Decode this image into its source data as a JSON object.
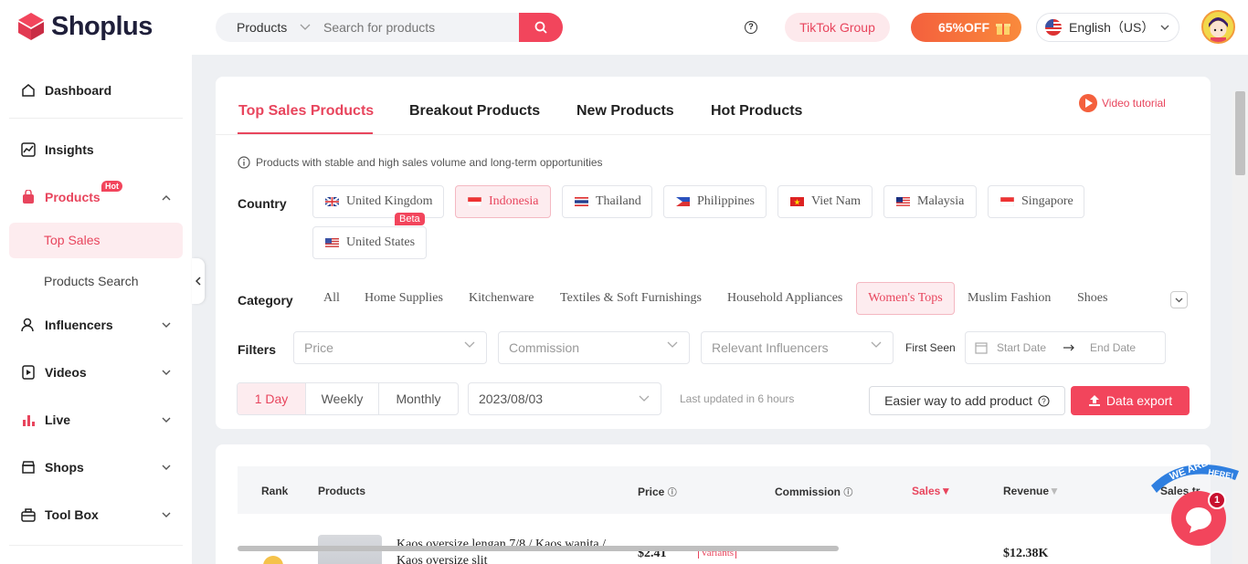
{
  "app": {
    "brand": "Shoplus"
  },
  "header": {
    "search_scope": "Products",
    "search_placeholder": "Search for products",
    "tiktok_label": "TikTok Group",
    "promo_label": "65%OFF",
    "language_label": "English（US）"
  },
  "sidebar": {
    "items": [
      {
        "label": "Dashboard",
        "icon": "home-icon"
      },
      {
        "label": "Insights",
        "icon": "chart-line-icon"
      },
      {
        "label": "Products",
        "icon": "bag-icon",
        "badge": "Hot"
      },
      {
        "label": "Influencers",
        "icon": "user-icon"
      },
      {
        "label": "Videos",
        "icon": "video-icon"
      },
      {
        "label": "Live",
        "icon": "bar-chart-icon"
      },
      {
        "label": "Shops",
        "icon": "shop-icon"
      },
      {
        "label": "Tool Box",
        "icon": "toolbox-icon"
      }
    ],
    "products_sub": [
      "Top Sales",
      "Products Search"
    ]
  },
  "tabs": [
    "Top Sales Products",
    "Breakout Products",
    "New Products",
    "Hot Products"
  ],
  "video_tutorial": "Video tutorial",
  "info_text": "Products with stable and high sales volume and long-term opportunities",
  "country": {
    "label": "Country",
    "options": [
      "United Kingdom",
      "Indonesia",
      "Thailand",
      "Philippines",
      "Viet Nam",
      "Malaysia",
      "Singapore",
      "United States"
    ],
    "selected": "Indonesia",
    "beta_badge": "Beta"
  },
  "category": {
    "label": "Category",
    "options": [
      "All",
      "Home Supplies",
      "Kitchenware",
      "Textiles & Soft Furnishings",
      "Household Appliances",
      "Women's Tops",
      "Muslim Fashion",
      "Shoes"
    ],
    "selected": "Women's Tops"
  },
  "filters": {
    "label": "Filters",
    "price_placeholder": "Price",
    "commission_placeholder": "Commission",
    "influencers_placeholder": "Relevant Influencers",
    "first_seen_label": "First Seen",
    "start_date_placeholder": "Start Date",
    "end_date_placeholder": "End Date"
  },
  "period": {
    "options": [
      "1 Day",
      "Weekly",
      "Monthly"
    ],
    "selected": "1 Day",
    "date": "2023/08/03"
  },
  "last_updated": "Last updated in 6 hours",
  "easier_label": "Easier way to add product",
  "export_label": "Data export",
  "table": {
    "headers": [
      "Rank",
      "Products",
      "Price",
      "Commission",
      "Sales",
      "Revenue",
      "Sales tr"
    ],
    "rows": [
      {
        "title": "Kaos oversize lengan 7/8 / Kaos wanita / Kaos oversize slit",
        "price": "$2.41",
        "variants": "Variants",
        "revenue": "$12.38K"
      }
    ]
  },
  "chat": {
    "badge": "1",
    "banner_left": "WE ARE",
    "banner_right": "HERE!"
  }
}
